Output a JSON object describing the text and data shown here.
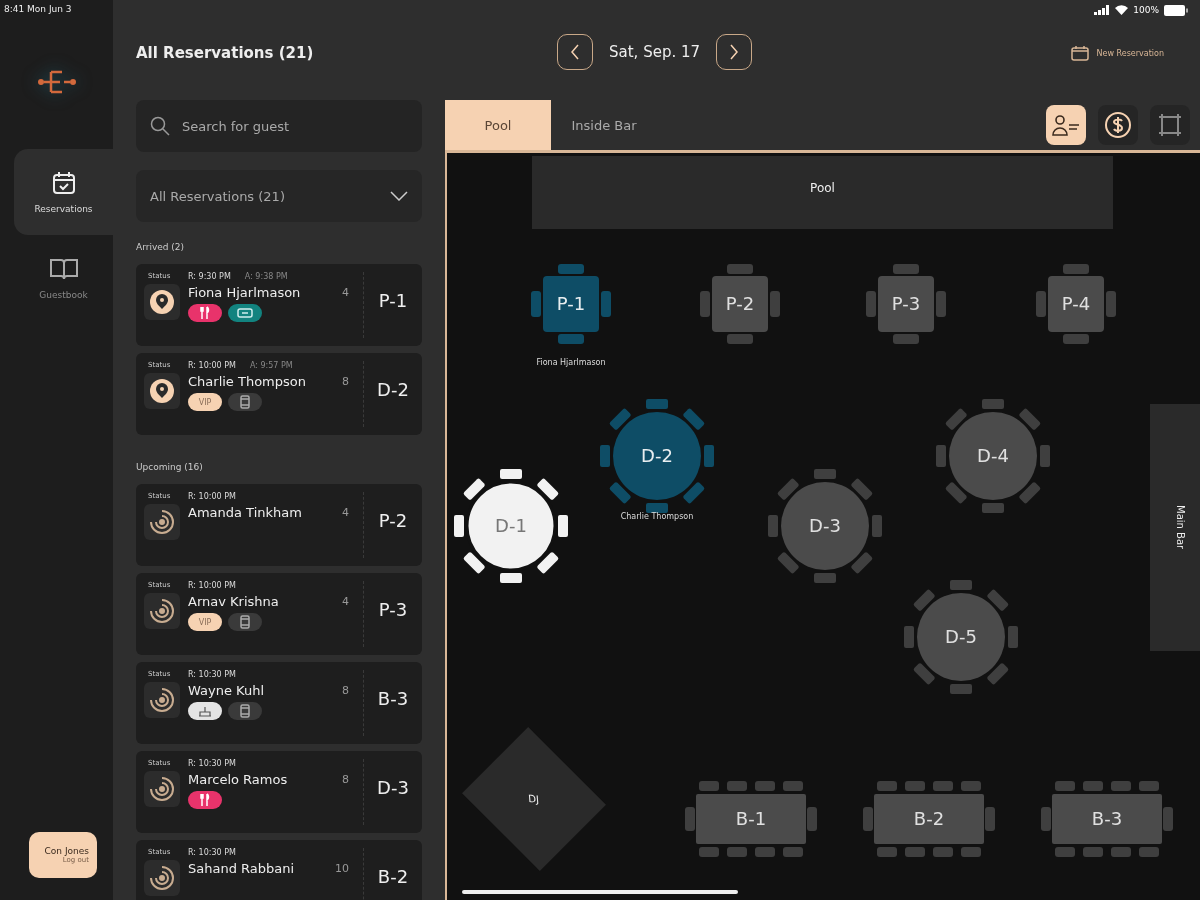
{
  "status_bar": {
    "time": "8:41 Mon Jun 3",
    "battery": "100%"
  },
  "nav": {
    "items": [
      {
        "label": "Reservations",
        "kind": "calendar",
        "selected": true
      },
      {
        "label": "Guestbook",
        "kind": "book",
        "selected": false
      }
    ],
    "user": {
      "name": "Con Jones",
      "action": "Log out"
    }
  },
  "header": {
    "title": "All Reservations (21)",
    "date": "Sat, Sep. 17",
    "new_button": "New Reservation"
  },
  "search": {
    "placeholder": "Search for guest"
  },
  "filter": {
    "value": "All Reservations (21)"
  },
  "sections": [
    {
      "title": "Arrived (2)",
      "cards": [
        {
          "status_label": "Status",
          "reserved": "R: 9:30 PM",
          "arrived": "A: 9:38 PM",
          "name": "Fiona Hjarlmason",
          "party": "4",
          "table": "P-1",
          "kind": "arrived",
          "tags": [
            {
              "kind": "food"
            },
            {
              "kind": "ticket"
            }
          ]
        },
        {
          "status_label": "Status",
          "reserved": "R: 10:00 PM",
          "arrived": "A: 9:57 PM",
          "name": "Charlie Thompson",
          "party": "8",
          "table": "D-2",
          "kind": "arrived",
          "tags": [
            {
              "kind": "vip",
              "text": "VIP"
            },
            {
              "kind": "phone"
            }
          ]
        }
      ]
    },
    {
      "title": "Upcoming (16)",
      "cards": [
        {
          "status_label": "Status",
          "reserved": "R: 10:00 PM",
          "name": "Amanda Tinkham",
          "party": "4",
          "table": "P-2",
          "kind": "upcoming"
        },
        {
          "status_label": "Status",
          "reserved": "R: 10:00 PM",
          "name": "Arnav Krishna",
          "party": "4",
          "table": "P-3",
          "kind": "upcoming",
          "tags": [
            {
              "kind": "vip",
              "text": "VIP"
            },
            {
              "kind": "phone"
            }
          ]
        },
        {
          "status_label": "Status",
          "reserved": "R: 10:30 PM",
          "name": "Wayne Kuhl",
          "party": "8",
          "table": "B-3",
          "kind": "upcoming",
          "tags": [
            {
              "kind": "cake"
            },
            {
              "kind": "phone"
            }
          ]
        },
        {
          "status_label": "Status",
          "reserved": "R: 10:30 PM",
          "name": "Marcelo Ramos",
          "party": "8",
          "table": "D-3",
          "kind": "upcoming",
          "tags": [
            {
              "kind": "food"
            }
          ]
        },
        {
          "status_label": "Status",
          "reserved": "R: 10:30 PM",
          "name": "Sahand Rabbani",
          "party": "10",
          "table": "B-2",
          "kind": "upcoming"
        }
      ]
    }
  ],
  "floor_tabs": [
    {
      "label": "Pool",
      "selected": true
    },
    {
      "label": "Inside Bar",
      "selected": false
    }
  ],
  "floor_tools": [
    {
      "kind": "guest",
      "selected": true
    },
    {
      "kind": "dollar",
      "selected": false
    },
    {
      "kind": "frame",
      "selected": false
    }
  ],
  "floor": {
    "area_label": "Pool",
    "bar_label": "Main Bar",
    "dj_label": "DJ",
    "tables": [
      {
        "label": "P-1",
        "kind": "square",
        "occupied": true,
        "selected": false,
        "guest": "Fiona Hjarlmason"
      },
      {
        "label": "P-2",
        "kind": "square",
        "occupied": false,
        "selected": false
      },
      {
        "label": "P-3",
        "kind": "square",
        "occupied": false,
        "selected": false
      },
      {
        "label": "P-4",
        "kind": "square",
        "occupied": false,
        "selected": false
      },
      {
        "label": "D-2",
        "kind": "round",
        "occupied": true,
        "selected": false,
        "guest": "Charlie Thompson"
      },
      {
        "label": "D-1",
        "kind": "round",
        "occupied": false,
        "selected": true
      },
      {
        "label": "D-3",
        "kind": "round",
        "occupied": false,
        "selected": false
      },
      {
        "label": "D-4",
        "kind": "round",
        "occupied": false,
        "selected": false
      },
      {
        "label": "D-5",
        "kind": "round",
        "occupied": false,
        "selected": false
      },
      {
        "label": "B-1",
        "kind": "long",
        "occupied": false,
        "selected": false
      },
      {
        "label": "B-2",
        "kind": "long",
        "occupied": false,
        "selected": false
      },
      {
        "label": "B-3",
        "kind": "long",
        "occupied": false,
        "selected": false
      }
    ]
  }
}
